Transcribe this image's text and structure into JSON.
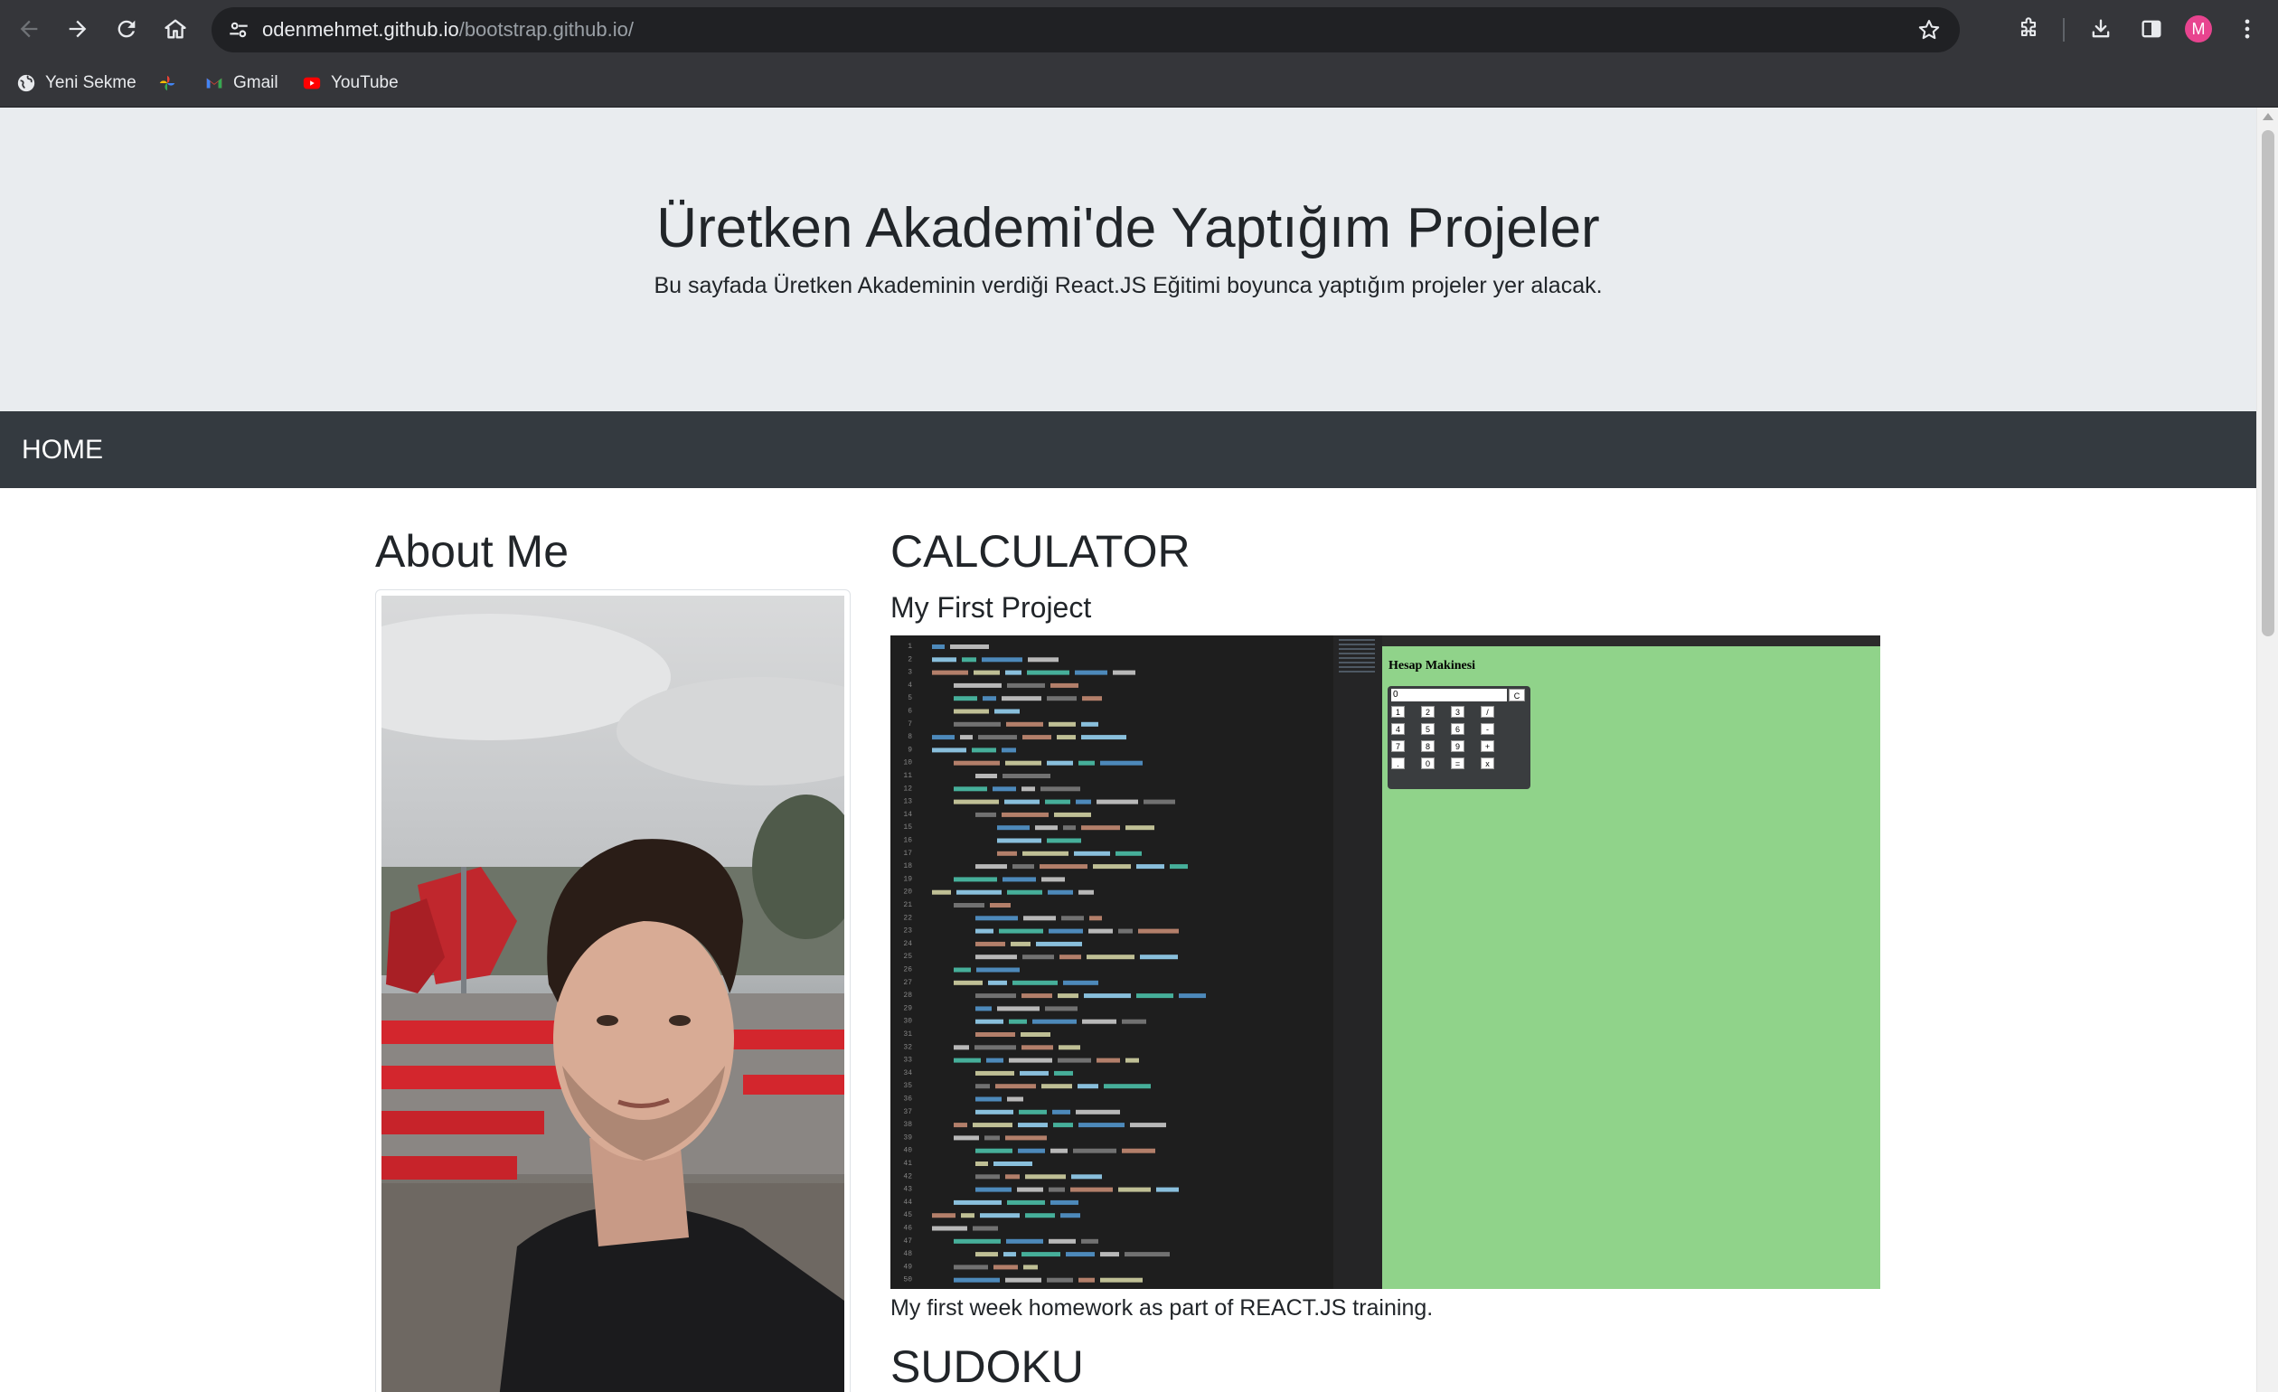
{
  "browser": {
    "url_host": "odenmehmet.github.io",
    "url_path": "/bootstrap.github.io/",
    "profile_initial": "M",
    "bookmarks": [
      {
        "label": "Yeni Sekme",
        "icon": "globe-icon"
      },
      {
        "label": "",
        "icon": "google-photos-icon"
      },
      {
        "label": "Gmail",
        "icon": "gmail-icon"
      },
      {
        "label": "YouTube",
        "icon": "youtube-icon"
      }
    ]
  },
  "header": {
    "title": "Üretken Akademi'de Yaptığım Projeler",
    "subtitle": "Bu sayfada Üretken Akademinin verdiği React.JS Eğitimi boyunca yaptığım projeler yer alacak."
  },
  "navbar": {
    "home_label": "HOME"
  },
  "about": {
    "title": "About Me"
  },
  "projects": {
    "calculator": {
      "title": "CALCULATOR",
      "subtitle": "My First Project",
      "caption": "My first week homework as part of REACT.JS training.",
      "preview_heading": "Hesap Makinesi",
      "preview_display": "0",
      "preview_keys": [
        "C",
        "1",
        "2",
        "3",
        "/",
        "4",
        "5",
        "6",
        "-",
        "7",
        "8",
        "9",
        "+",
        ".",
        "0",
        "=",
        "x"
      ]
    },
    "sudoku": {
      "title": "SUDOKU"
    }
  },
  "colors": {
    "jumbotron_bg": "#e9ecef",
    "navbar_bg": "#343a40",
    "preview_green": "#90d38a",
    "code_bg": "#1e1e1e"
  }
}
